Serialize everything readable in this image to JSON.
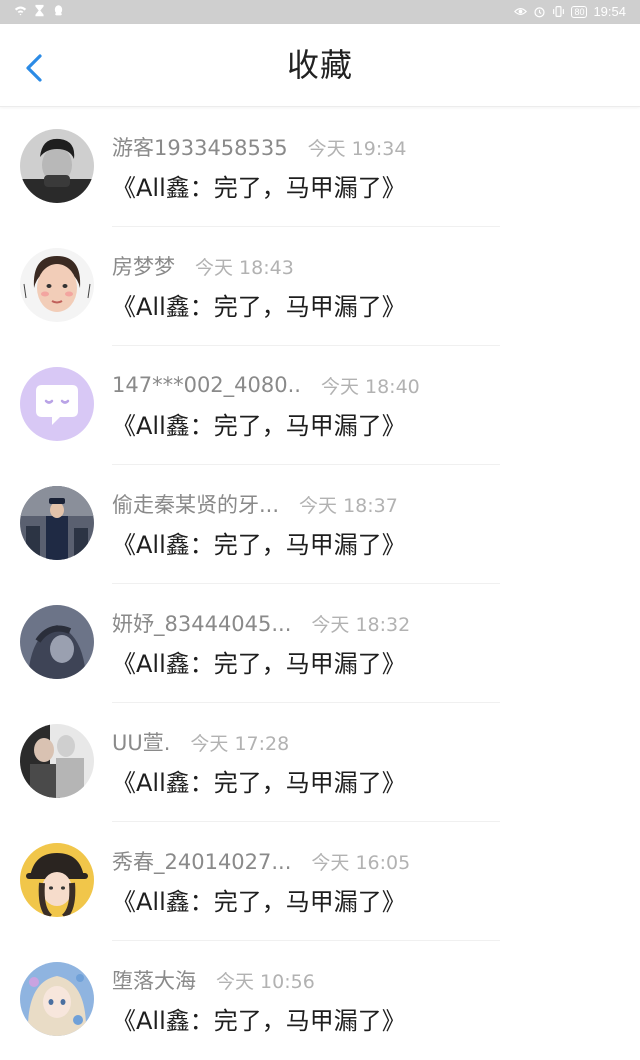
{
  "status_bar": {
    "time": "19:54",
    "battery": "80"
  },
  "header": {
    "title": "收藏"
  },
  "colors": {
    "accent": "#2b8be6",
    "name": "#8a8a8a",
    "time": "#b2b2b2",
    "content": "#1e1e1e"
  },
  "items": [
    {
      "name": "游客1933458535",
      "time": "今天 19:34",
      "content": "《All鑫：完了，马甲漏了》",
      "avatar": "boy-bw-photo"
    },
    {
      "name": "房梦梦",
      "time": "今天 18:43",
      "content": "《All鑫：完了，马甲漏了》",
      "avatar": "girl-face-photo"
    },
    {
      "name": "147***002_4080..",
      "time": "今天 18:40",
      "content": "《All鑫：完了，马甲漏了》",
      "avatar": "default-chat-bubble"
    },
    {
      "name": "偷走秦某贤的牙...",
      "time": "今天 18:37",
      "content": "《All鑫：完了，马甲漏了》",
      "avatar": "uniform-person-photo"
    },
    {
      "name": "妍妤_83444045...",
      "time": "今天 18:32",
      "content": "《All鑫：完了，马甲漏了》",
      "avatar": "hooded-figure-photo"
    },
    {
      "name": "ᑌᑌ萱.",
      "time": "今天 17:28",
      "content": "《All鑫：完了，马甲漏了》",
      "avatar": "couple-photo"
    },
    {
      "name": "秀春_24014027...",
      "time": "今天 16:05",
      "content": "《All鑫：完了，马甲漏了》",
      "avatar": "girl-hat-photo"
    },
    {
      "name": "堕落大海",
      "time": "今天 10:56",
      "content": "《All鑫：完了，马甲漏了》",
      "avatar": "anime-girl-art"
    }
  ]
}
